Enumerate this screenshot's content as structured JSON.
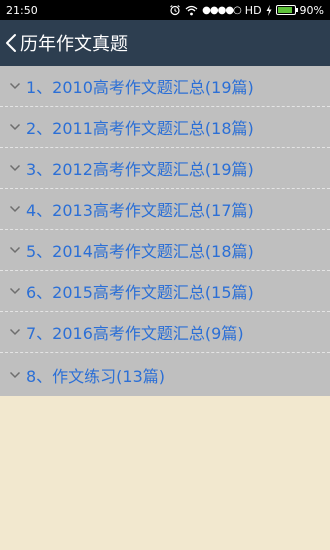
{
  "status_bar": {
    "time": "21:50",
    "signal": "●●●●○",
    "network": "HD",
    "battery_percent": "90%",
    "battery_level": 0.9,
    "icons": [
      "alarm-icon",
      "wifi-icon",
      "signal-icon",
      "charging-icon",
      "battery-icon"
    ]
  },
  "header": {
    "back_icon": "chevron-left-icon",
    "title": "历年作文真题"
  },
  "list": {
    "items": [
      {
        "label": "1、2010高考作文题汇总(19篇)"
      },
      {
        "label": "2、2011高考作文题汇总(18篇)"
      },
      {
        "label": "3、2012高考作文题汇总(19篇)"
      },
      {
        "label": "4、2013高考作文题汇总(17篇)"
      },
      {
        "label": "5、2014高考作文题汇总(18篇)"
      },
      {
        "label": "6、2015高考作文题汇总(15篇)"
      },
      {
        "label": "7、2016高考作文题汇总(9篇)"
      },
      {
        "label": "8、作文练习(13篇)"
      }
    ]
  },
  "colors": {
    "header_bg": "#2d3e50",
    "list_bg": "#bfbfbf",
    "item_text": "#2b6fd6",
    "page_bg": "#f2e8cf"
  }
}
